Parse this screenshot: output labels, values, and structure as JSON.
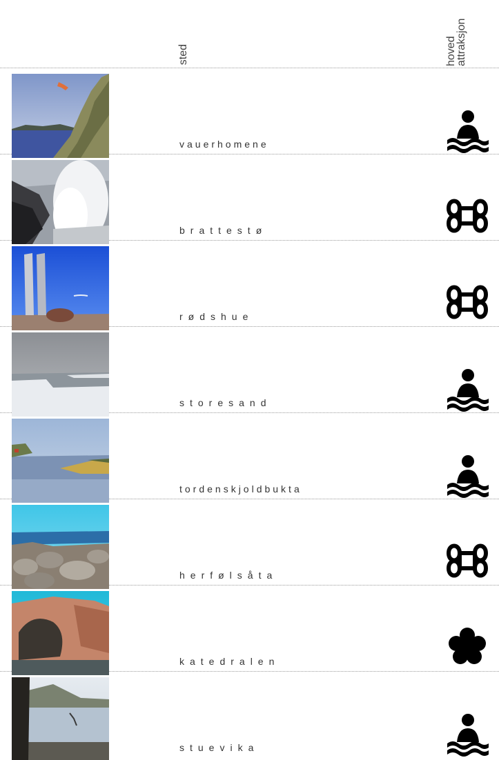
{
  "header": {
    "col_sted": "sted",
    "col_attraksjon": "hoved attraksjon"
  },
  "places": [
    {
      "name": "vauerhomene",
      "attraction_icon": "swimmer-icon"
    },
    {
      "name": "brattestø",
      "attraction_icon": "command-key-icon"
    },
    {
      "name": "rødshue",
      "attraction_icon": "command-key-icon"
    },
    {
      "name": "storesand",
      "attraction_icon": "swimmer-icon"
    },
    {
      "name": "tordenskjoldbukta",
      "attraction_icon": "swimmer-icon"
    },
    {
      "name": "herfølsåta",
      "attraction_icon": "command-key-icon"
    },
    {
      "name": "katedralen",
      "attraction_icon": "flower-icon"
    },
    {
      "name": "stuevika",
      "attraction_icon": "swimmer-icon"
    }
  ]
}
